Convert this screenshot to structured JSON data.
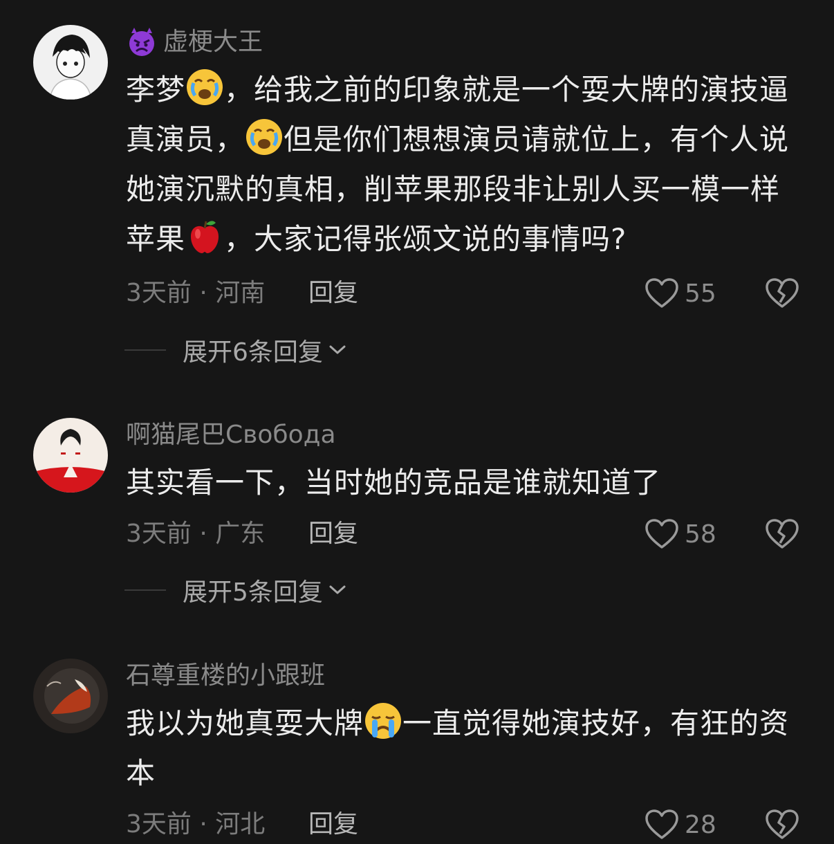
{
  "comments": [
    {
      "username": "虚梗大王",
      "badge_icon": "devil-emoji-icon",
      "content_parts": [
        "李梦",
        "，给我之前的印象就是一个耍大牌的演技逼真演员，",
        "但是你们想想演员请就位上，有个人说她演沉默的真相，削苹果那段非让别人买一模一样苹果",
        "，大家记得张颂文说的事情吗?"
      ],
      "content_icons": [
        "crying-face-icon",
        "crying-face-icon",
        "apple-emoji-icon"
      ],
      "time_location": "3天前 · 河南",
      "reply_label": "回复",
      "likes": "55",
      "expand_label": "展开6条回复"
    },
    {
      "username": "啊猫尾巴Свобода",
      "content_parts": [
        "其实看一下，当时她的竞品是谁就知道了"
      ],
      "time_location": "3天前 · 广东",
      "reply_label": "回复",
      "likes": "58",
      "expand_label": "展开5条回复"
    },
    {
      "username": "石尊重楼的小跟班",
      "content_parts": [
        "我以为她真耍大牌",
        "一直觉得她演技好，有狂的资本"
      ],
      "content_icons": [
        "loudly-crying-face-icon"
      ],
      "time_location": "3天前 · 河北",
      "reply_label": "回复",
      "likes": "28"
    }
  ],
  "colors": {
    "background": "#161616",
    "username": "#8a8a8a",
    "content": "#ececec",
    "meta": "#7c7c7c"
  }
}
